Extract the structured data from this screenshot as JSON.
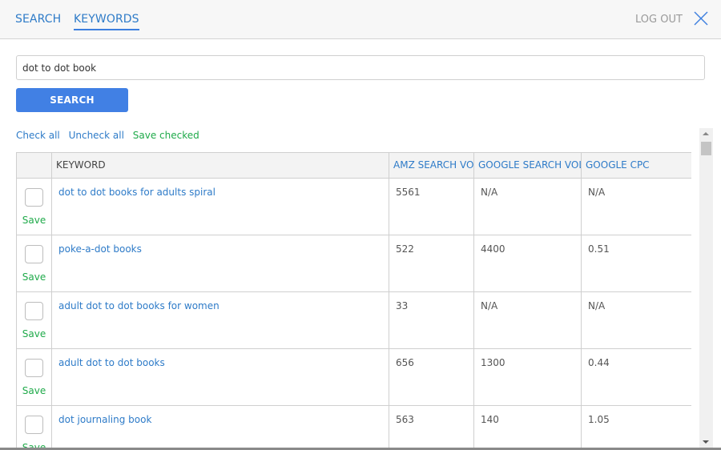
{
  "nav": {
    "tabs": [
      {
        "label": "SEARCH",
        "active": false
      },
      {
        "label": "KEYWORDS",
        "active": true
      }
    ],
    "logout_label": "LOG OUT",
    "close_icon": "close-icon"
  },
  "search": {
    "query_value": "dot to dot book",
    "button_label": "SEARCH"
  },
  "actions": {
    "check_all": "Check all",
    "uncheck_all": "Uncheck all",
    "save_checked": "Save checked"
  },
  "table": {
    "columns": [
      "",
      "KEYWORD",
      "AMZ SEARCH VOL",
      "GOOGLE SEARCH VOL",
      "GOOGLE CPC"
    ],
    "save_label": "Save",
    "rows": [
      {
        "keyword": "dot to dot books for adults spiral",
        "amz_search_vol": "5561",
        "google_search_vol": "N/A",
        "google_cpc": "N/A",
        "checked": false
      },
      {
        "keyword": "poke-a-dot books",
        "amz_search_vol": "522",
        "google_search_vol": "4400",
        "google_cpc": "0.51",
        "checked": false
      },
      {
        "keyword": "adult dot to dot books for women",
        "amz_search_vol": "33",
        "google_search_vol": "N/A",
        "google_cpc": "N/A",
        "checked": false
      },
      {
        "keyword": "adult dot to dot books",
        "amz_search_vol": "656",
        "google_search_vol": "1300",
        "google_cpc": "0.44",
        "checked": false
      },
      {
        "keyword": "dot journaling book",
        "amz_search_vol": "563",
        "google_search_vol": "140",
        "google_cpc": "1.05",
        "checked": false
      }
    ]
  },
  "colors": {
    "link_blue": "#2e7bc8",
    "save_green": "#1faa4a",
    "button_blue": "#4180e4",
    "header_bg": "#f7f7f7"
  }
}
